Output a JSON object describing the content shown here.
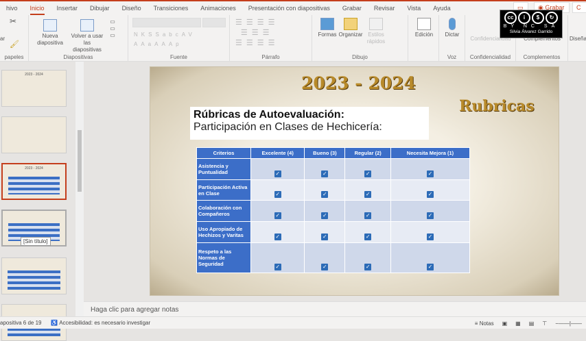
{
  "tabs": [
    "hivo",
    "Inicio",
    "Insertar",
    "Dibujar",
    "Diseño",
    "Transiciones",
    "Animaciones",
    "Presentación con diapositivas",
    "Grabar",
    "Revisar",
    "Vista",
    "Ayuda"
  ],
  "top_buttons": {
    "record": "Grabar",
    "share": "C"
  },
  "ribbon": {
    "groups": {
      "clipboard": "papeles",
      "slides": "Diapositivas",
      "font": "Fuente",
      "paragraph": "Párrafo",
      "drawing": "Dibujo",
      "voice": "Voz",
      "confidentiality": "Confidencialidad",
      "addins": "Complementos"
    },
    "buttons": {
      "paste": "ar",
      "new_slide": "Nueva diapositiva",
      "reuse": "Volver a usar las diapositivas",
      "shapes": "Formas",
      "arrange": "Organizar",
      "quick_styles": "Estilos rápidos",
      "editing": "Edición",
      "dictate": "Dictar",
      "confidential": "Confidencialidad",
      "addins": "Complementos",
      "designer": "Diseña"
    },
    "font_format": [
      "N",
      "K",
      "S",
      "S",
      "abc",
      "AV",
      "A",
      "Aa",
      "A",
      "A",
      "Ap"
    ]
  },
  "license": {
    "badges": [
      "cc",
      "i",
      "$",
      "↻"
    ],
    "terms": "BY NC SA",
    "author": "Silvia Álvarez Garrido"
  },
  "thumbnails": {
    "tooltip": "[Sin título]",
    "year": "2023 - 2024"
  },
  "slide": {
    "year": "2023 - 2024",
    "logo": "Rubricas",
    "title": "Rúbricas de Autoevaluación:",
    "subtitle": "Participación en Clases de Hechicería:",
    "table": {
      "headers": [
        "Criterios",
        "Excelente (4)",
        "Bueno (3)",
        "Regular (2)",
        "Necesita Mejora (1)"
      ],
      "rows": [
        "Asistencia y Puntualidad",
        "Participación Activa en Clase",
        "Colaboración con Compañeros",
        "Uso Apropiado de Hechizos y Varitas",
        "Respeto a las Normas de Seguridad"
      ],
      "checked": true
    }
  },
  "notes_placeholder": "Haga clic para agregar notas",
  "status": {
    "slide": "apositiva 6 de 19",
    "accessibility": "Accesibilidad: es necesario investigar",
    "notes": "Notas"
  }
}
